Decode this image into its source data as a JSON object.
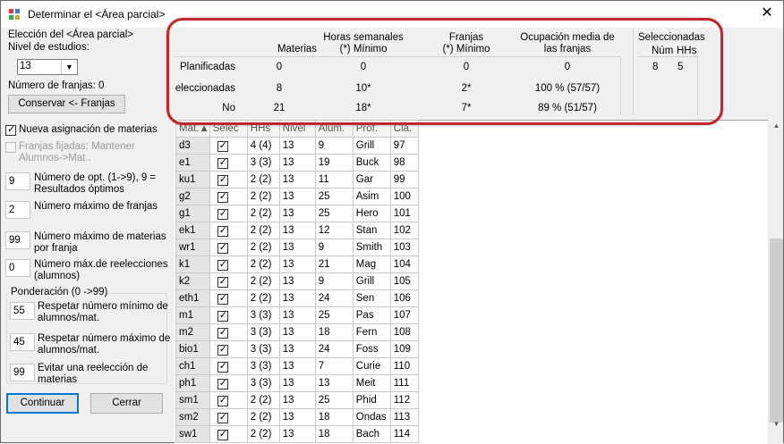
{
  "window": {
    "title": "Determinar el <Área parcial>"
  },
  "left": {
    "eleccion_label": "Elección del <Área parcial>",
    "nivel_label": "Nivel de estudios:",
    "nivel_value": "13",
    "franjas_label": "Número de franjas: 0",
    "conservar_button": "Conservar <- Franjas",
    "nueva_asignacion": "Nueva asignación de materias",
    "franjas_fijadas_1": "Franjas fijadas: Mantener",
    "franjas_fijadas_2": "Alumnos->Mat..",
    "opt_value": "9",
    "opt_label_1": "Número de opt. (1->9), 9 =",
    "opt_label_2": "Resultados óptimos",
    "max_franjas_value": "2",
    "max_franjas_label": "Número máximo de franjas",
    "max_materias_value": "99",
    "max_materias_label_1": "Número máximo de materias",
    "max_materias_label_2": "por franja",
    "reelecciones_value": "0",
    "reelecciones_label_1": "Número máx.de reelecciones",
    "reelecciones_label_2": "(alumnos)",
    "ponderacion_title": "Ponderación (0 ->99)",
    "min_alumnos_value": "55",
    "min_alumnos_label_1": "Respetar número mínimo de",
    "min_alumnos_label_2": "alumnos/mat.",
    "max_alumnos_value": "45",
    "max_alumnos_label_1": "Respetar número máximo de",
    "max_alumnos_label_2": "alumnos/mat.",
    "evitar_value": "99",
    "evitar_label_1": "Evitar una reelección de",
    "evitar_label_2": "materias",
    "continuar_button": "Continuar",
    "cerrar_button": "Cerrar"
  },
  "stats": {
    "col_materias": "Materias",
    "col_horas_1": "Horas semanales",
    "col_horas_2": "(*) Mínimo",
    "col_franjas_1": "Franjas",
    "col_franjas_2": "(*) Mínimo",
    "col_ocup_1": "Ocupación media de",
    "col_ocup_2": "las franjas",
    "sel_title": "Seleccionadas",
    "sel_num_label": "Núm",
    "sel_hhs_label": "HHs",
    "sel_num": "8",
    "sel_hhs": "5",
    "rows": [
      {
        "label": "Planificadas",
        "materias": "0",
        "horas": "0",
        "franjas": "0",
        "ocup": "0"
      },
      {
        "label": "eleccionadas",
        "materias": "8",
        "horas": "10*",
        "franjas": "2*",
        "ocup": "100 % (57/57)"
      },
      {
        "label": "No",
        "materias": "21",
        "horas": "18*",
        "franjas": "7*",
        "ocup": "89 % (51/57)"
      }
    ]
  },
  "table": {
    "headers": [
      "Mat.",
      "Selec",
      "HHs",
      "Nivel",
      "Alum.",
      "Prof.",
      "Cla."
    ],
    "rows": [
      {
        "mat": "d3",
        "hhs": "4 (4)",
        "nivel": "13",
        "alum": "9",
        "prof": "Grill",
        "cla": "97"
      },
      {
        "mat": "e1",
        "hhs": "3 (3)",
        "nivel": "13",
        "alum": "19",
        "prof": "Buck",
        "cla": "98"
      },
      {
        "mat": "ku1",
        "hhs": "2 (2)",
        "nivel": "13",
        "alum": "11",
        "prof": "Gar",
        "cla": "99"
      },
      {
        "mat": "g2",
        "hhs": "2 (2)",
        "nivel": "13",
        "alum": "25",
        "prof": "Asim",
        "cla": "100"
      },
      {
        "mat": "g1",
        "hhs": "2 (2)",
        "nivel": "13",
        "alum": "25",
        "prof": "Hero",
        "cla": "101"
      },
      {
        "mat": "ek1",
        "hhs": "2 (2)",
        "nivel": "13",
        "alum": "12",
        "prof": "Stan",
        "cla": "102"
      },
      {
        "mat": "wr1",
        "hhs": "2 (2)",
        "nivel": "13",
        "alum": "9",
        "prof": "Smith",
        "cla": "103"
      },
      {
        "mat": "k1",
        "hhs": "2 (2)",
        "nivel": "13",
        "alum": "21",
        "prof": "Mag",
        "cla": "104"
      },
      {
        "mat": "k2",
        "hhs": "2 (2)",
        "nivel": "13",
        "alum": "9",
        "prof": "Grill",
        "cla": "105"
      },
      {
        "mat": "eth1",
        "hhs": "2 (2)",
        "nivel": "13",
        "alum": "24",
        "prof": "Sen",
        "cla": "106"
      },
      {
        "mat": "m1",
        "hhs": "3 (3)",
        "nivel": "13",
        "alum": "25",
        "prof": "Pas",
        "cla": "107"
      },
      {
        "mat": "m2",
        "hhs": "3 (3)",
        "nivel": "13",
        "alum": "18",
        "prof": "Fern",
        "cla": "108"
      },
      {
        "mat": "bio1",
        "hhs": "3 (3)",
        "nivel": "13",
        "alum": "24",
        "prof": "Foss",
        "cla": "109"
      },
      {
        "mat": "ch1",
        "hhs": "3 (3)",
        "nivel": "13",
        "alum": "7",
        "prof": "Curie",
        "cla": "110"
      },
      {
        "mat": "ph1",
        "hhs": "3 (3)",
        "nivel": "13",
        "alum": "13",
        "prof": "Meit",
        "cla": "111"
      },
      {
        "mat": "sm1",
        "hhs": "2 (2)",
        "nivel": "13",
        "alum": "25",
        "prof": "Phid",
        "cla": "112"
      },
      {
        "mat": "sm2",
        "hhs": "2 (2)",
        "nivel": "13",
        "alum": "18",
        "prof": "Ondas",
        "cla": "113"
      },
      {
        "mat": "sw1",
        "hhs": "2 (2)",
        "nivel": "13",
        "alum": "18",
        "prof": "Bach",
        "cla": "114"
      }
    ]
  },
  "colors": {
    "highlight_border": "#c0262c",
    "button_focus": "#0078d7"
  }
}
